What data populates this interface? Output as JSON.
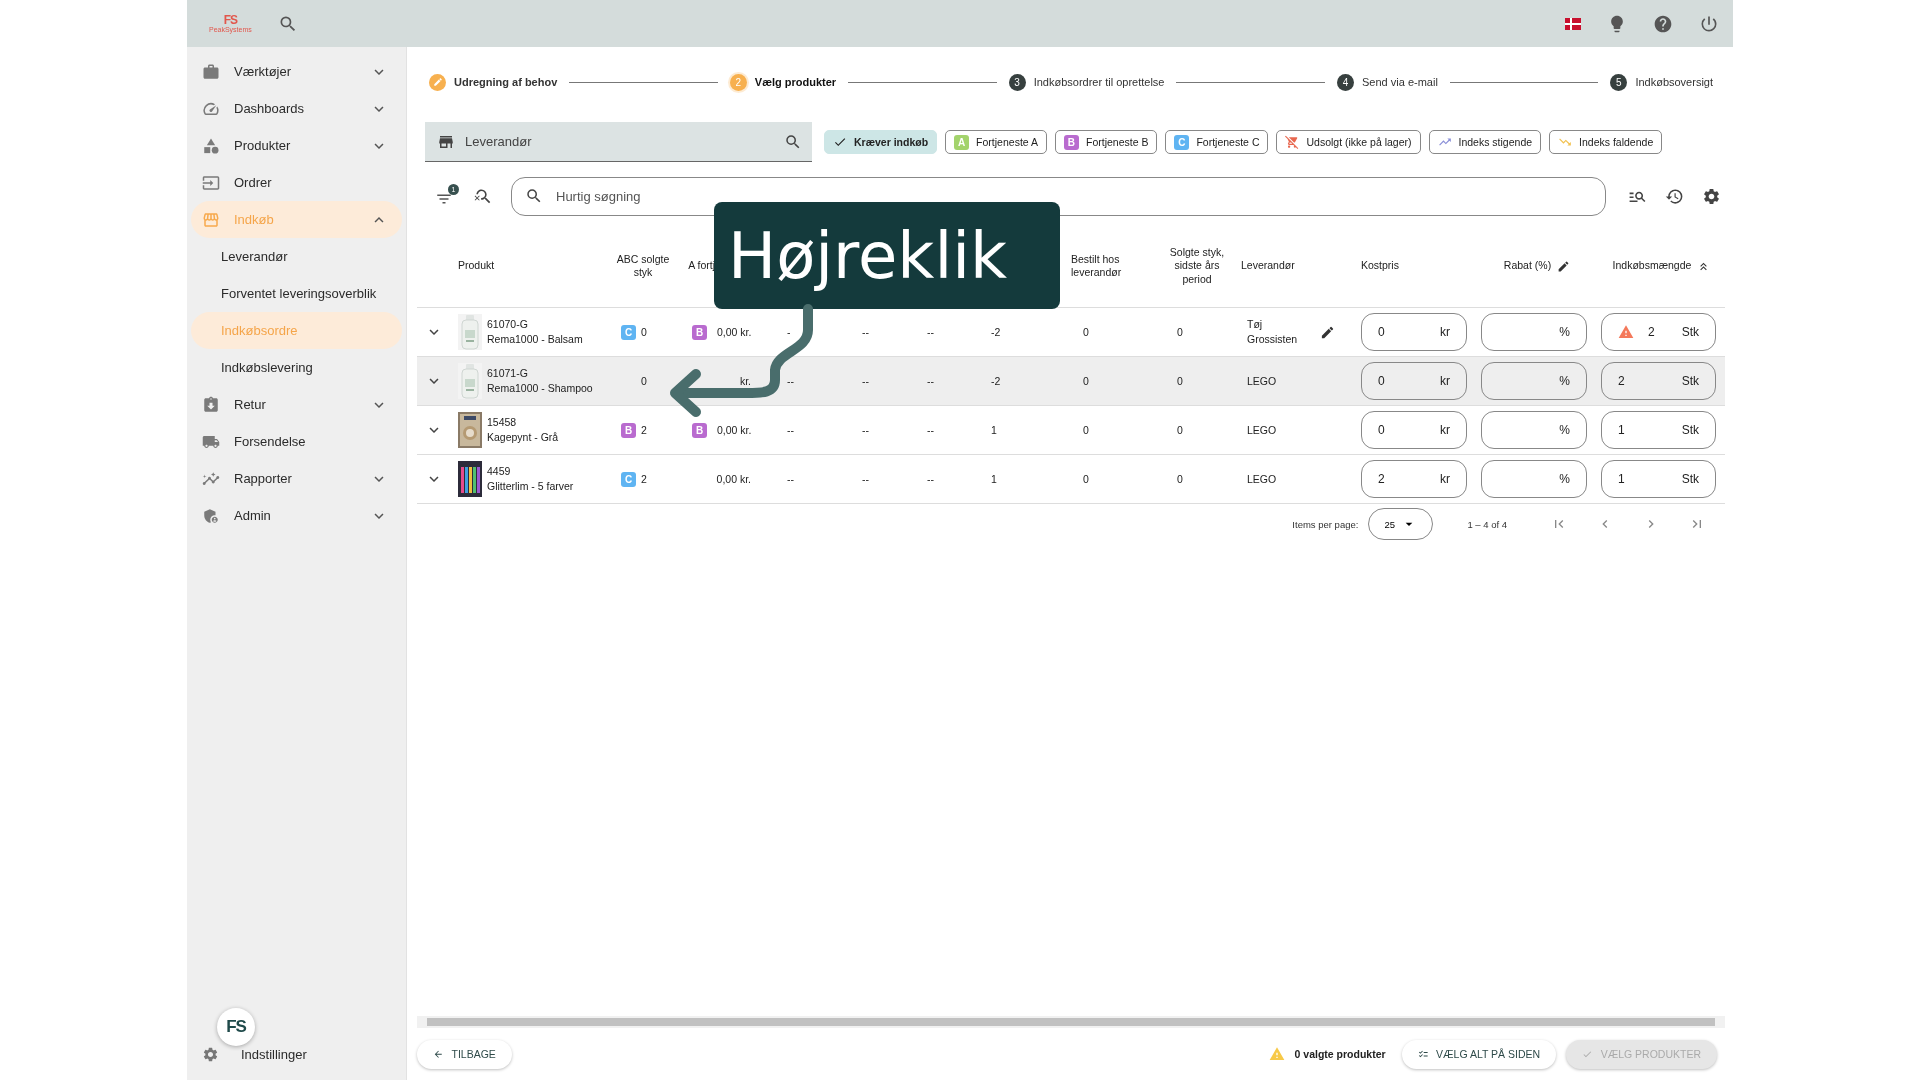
{
  "topbar": {
    "logo_mark": "FS",
    "logo_name": "PeakSystems"
  },
  "sidebar": {
    "items": [
      {
        "label": "Værktøjer",
        "kind": "group",
        "expanded": false,
        "selected": false
      },
      {
        "label": "Dashboards",
        "kind": "group",
        "expanded": false,
        "selected": false
      },
      {
        "label": "Produkter",
        "kind": "group",
        "expanded": false,
        "selected": false
      },
      {
        "label": "Ordrer",
        "kind": "link",
        "selected": false
      },
      {
        "label": "Indkøb",
        "kind": "group",
        "expanded": true,
        "selected": true,
        "children": [
          {
            "label": "Leverandør",
            "selected": false
          },
          {
            "label": "Forventet leveringsoverblik",
            "selected": false
          },
          {
            "label": "Indkøbsordre",
            "selected": true
          },
          {
            "label": "Indkøbslevering",
            "selected": false
          }
        ]
      },
      {
        "label": "Retur",
        "kind": "group",
        "expanded": false,
        "selected": false
      },
      {
        "label": "Forsendelse",
        "kind": "link",
        "selected": false
      },
      {
        "label": "Rapporter",
        "kind": "group",
        "expanded": false,
        "selected": false
      },
      {
        "label": "Admin",
        "kind": "group",
        "expanded": false,
        "selected": false
      }
    ],
    "settings": "Indstillinger",
    "chat_mark": "FS"
  },
  "stepper": [
    {
      "label": "Udregning af behov",
      "completed": true,
      "selected": false
    },
    {
      "number": "2",
      "label": "Vælg produkter",
      "completed": false,
      "selected": true
    },
    {
      "number": "3",
      "label": "Indkøbsordrer til oprettelse",
      "completed": false,
      "selected": false
    },
    {
      "number": "4",
      "label": "Send via e-mail",
      "completed": false,
      "selected": false
    },
    {
      "number": "5",
      "label": "Indkøbsoversigt",
      "completed": false,
      "selected": false
    }
  ],
  "supplier_field": {
    "placeholder": "Leverandør"
  },
  "filter_chips": [
    {
      "label": "Kræver indkøb",
      "kind": "plain",
      "selected": true
    },
    {
      "label": "Fortjeneste A",
      "kind": "badge",
      "badge": "A",
      "color": "#a3d36c",
      "selected": false
    },
    {
      "label": "Fortjeneste B",
      "kind": "badge",
      "badge": "B",
      "color": "#b96bcf",
      "selected": false
    },
    {
      "label": "Fortjeneste C",
      "kind": "badge",
      "badge": "C",
      "color": "#5fb4f2",
      "selected": false
    },
    {
      "label": "Udsolgt (ikke på lager)",
      "kind": "soldout",
      "selected": false
    },
    {
      "label": "Indeks stigende",
      "kind": "rising",
      "selected": false
    },
    {
      "label": "Indeks faldende",
      "kind": "falling",
      "selected": false
    }
  ],
  "toolbar": {
    "filter_count": "1",
    "search_placeholder": "Hurtig søgning"
  },
  "table": {
    "columns": [
      {
        "label": "Produkt",
        "kind": "plain"
      },
      {
        "label": "ABC solgte styk",
        "kind": "plain"
      },
      {
        "label": "A fortj",
        "kind": "plain"
      },
      {
        "label": "Bestilt hos leverandør",
        "kind": "plain"
      },
      {
        "label": "Solgte styk, sidste års period",
        "kind": "plain"
      },
      {
        "label": "Leverandør",
        "kind": "plain"
      },
      {
        "label": "Kostpris",
        "kind": "plain"
      },
      {
        "label": "Rabat (%)",
        "kind": "edit"
      },
      {
        "label": "Indkøbsmængde",
        "kind": "sort"
      }
    ],
    "rows": [
      {
        "selected": false,
        "sku": "61070-G",
        "name": "Rema1000 - Balsam",
        "abc": {
          "class": "C",
          "color": "#5fb4f2"
        },
        "sold": "0",
        "profit_badge": {
          "class": "B",
          "color": "#b96bcf"
        },
        "profit": "0,00 kr.",
        "column_5": "-",
        "column_6": "--",
        "column_7": "--",
        "column_8": "-2",
        "ordered": "0",
        "sold_last_year": "0",
        "supplier": "Tøj Grossisten",
        "supplier_editable": true,
        "cost": "0",
        "cost_unit": "kr",
        "discount_unit": "%",
        "quantity": "2",
        "quantity_unit": "Stk",
        "warning": true
      },
      {
        "selected": true,
        "sku": "61071-G",
        "name": "Rema1000 - Shampoo",
        "sold": "0",
        "profit": "kr.",
        "column_5": "--",
        "column_6": "--",
        "column_7": "--",
        "column_8": "-2",
        "ordered": "0",
        "sold_last_year": "0",
        "supplier": "LEGO",
        "supplier_editable": false,
        "cost": "0",
        "cost_unit": "kr",
        "discount_unit": "%",
        "quantity": "2",
        "quantity_unit": "Stk",
        "warning": false
      },
      {
        "selected": false,
        "sku": "15458",
        "name": "Kagepynt - Grå",
        "abc": {
          "class": "B",
          "color": "#b96bcf"
        },
        "sold": "2",
        "profit_badge": {
          "class": "B",
          "color": "#b96bcf"
        },
        "profit": "0,00 kr.",
        "column_5": "--",
        "column_6": "--",
        "column_7": "--",
        "column_8": "1",
        "ordered": "0",
        "sold_last_year": "0",
        "supplier": "LEGO",
        "supplier_editable": false,
        "cost": "0",
        "cost_unit": "kr",
        "discount_unit": "%",
        "quantity": "1",
        "quantity_unit": "Stk",
        "warning": false
      },
      {
        "selected": false,
        "sku": "4459",
        "name": "Glitterlim - 5 farver",
        "abc": {
          "class": "C",
          "color": "#5fb4f2"
        },
        "sold": "2",
        "profit": "0,00 kr.",
        "column_5": "--",
        "column_6": "--",
        "column_7": "--",
        "column_8": "1",
        "ordered": "0",
        "sold_last_year": "0",
        "supplier": "LEGO",
        "supplier_editable": false,
        "cost": "2",
        "cost_unit": "kr",
        "discount_unit": "%",
        "quantity": "1",
        "quantity_unit": "Stk",
        "warning": false
      }
    ]
  },
  "pagination": {
    "label": "Items per page:",
    "page_size": "25",
    "range": "1 – 4 of 4"
  },
  "footer": {
    "back": "TILBAGE",
    "selected_count": "0 valgte produkter",
    "select_all": "VÆLG ALT PÅ SIDEN",
    "confirm": "VÆLG PRODUKTER",
    "confirm_disabled": true
  },
  "annotation": {
    "text": "Højreklik"
  }
}
